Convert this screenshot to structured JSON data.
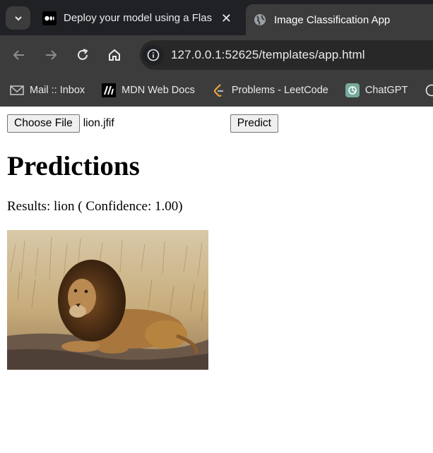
{
  "browser": {
    "tabs": [
      {
        "title": "Deploy your model using a Flask",
        "favicon": "medium-icon",
        "active": false
      },
      {
        "title": "Image Classification App",
        "favicon": "globe-icon",
        "active": true
      }
    ],
    "url": "127.0.0.1:52625/templates/app.html",
    "bookmarks": [
      {
        "label": "Mail :: Inbox",
        "icon": "mail-icon"
      },
      {
        "label": "MDN Web Docs",
        "icon": "mdn-icon"
      },
      {
        "label": "Problems - LeetCode",
        "icon": "leetcode-icon"
      },
      {
        "label": "ChatGPT",
        "icon": "chatgpt-icon"
      }
    ]
  },
  "form": {
    "choose_file_label": "Choose File",
    "file_name": "lion.jfif",
    "predict_label": "Predict"
  },
  "main": {
    "heading": "Predictions",
    "results": "Results: lion ( Confidence: 1.00)",
    "image_subject": "lion"
  },
  "colors": {
    "chrome_dark": "#202124",
    "chrome_toolbar": "#3c3c3c",
    "chrome_text": "#e8eaed",
    "button_bg": "#efefef"
  }
}
